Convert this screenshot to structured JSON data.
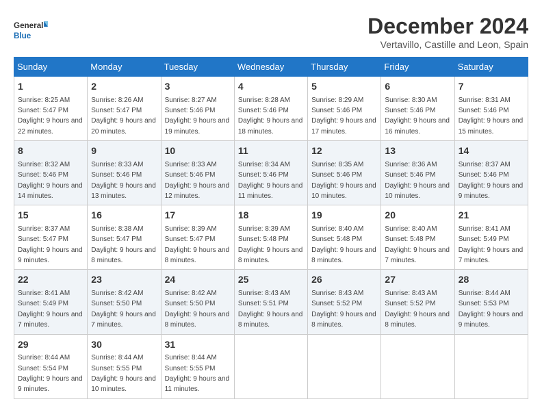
{
  "logo": {
    "general": "General",
    "blue": "Blue"
  },
  "title": "December 2024",
  "subtitle": "Vertavillo, Castille and Leon, Spain",
  "days_of_week": [
    "Sunday",
    "Monday",
    "Tuesday",
    "Wednesday",
    "Thursday",
    "Friday",
    "Saturday"
  ],
  "weeks": [
    [
      {
        "day": "1",
        "sunrise": "8:25 AM",
        "sunset": "5:47 PM",
        "daylight": "9 hours and 22 minutes."
      },
      {
        "day": "2",
        "sunrise": "8:26 AM",
        "sunset": "5:47 PM",
        "daylight": "9 hours and 20 minutes."
      },
      {
        "day": "3",
        "sunrise": "8:27 AM",
        "sunset": "5:46 PM",
        "daylight": "9 hours and 19 minutes."
      },
      {
        "day": "4",
        "sunrise": "8:28 AM",
        "sunset": "5:46 PM",
        "daylight": "9 hours and 18 minutes."
      },
      {
        "day": "5",
        "sunrise": "8:29 AM",
        "sunset": "5:46 PM",
        "daylight": "9 hours and 17 minutes."
      },
      {
        "day": "6",
        "sunrise": "8:30 AM",
        "sunset": "5:46 PM",
        "daylight": "9 hours and 16 minutes."
      },
      {
        "day": "7",
        "sunrise": "8:31 AM",
        "sunset": "5:46 PM",
        "daylight": "9 hours and 15 minutes."
      }
    ],
    [
      {
        "day": "8",
        "sunrise": "8:32 AM",
        "sunset": "5:46 PM",
        "daylight": "9 hours and 14 minutes."
      },
      {
        "day": "9",
        "sunrise": "8:33 AM",
        "sunset": "5:46 PM",
        "daylight": "9 hours and 13 minutes."
      },
      {
        "day": "10",
        "sunrise": "8:33 AM",
        "sunset": "5:46 PM",
        "daylight": "9 hours and 12 minutes."
      },
      {
        "day": "11",
        "sunrise": "8:34 AM",
        "sunset": "5:46 PM",
        "daylight": "9 hours and 11 minutes."
      },
      {
        "day": "12",
        "sunrise": "8:35 AM",
        "sunset": "5:46 PM",
        "daylight": "9 hours and 10 minutes."
      },
      {
        "day": "13",
        "sunrise": "8:36 AM",
        "sunset": "5:46 PM",
        "daylight": "9 hours and 10 minutes."
      },
      {
        "day": "14",
        "sunrise": "8:37 AM",
        "sunset": "5:46 PM",
        "daylight": "9 hours and 9 minutes."
      }
    ],
    [
      {
        "day": "15",
        "sunrise": "8:37 AM",
        "sunset": "5:47 PM",
        "daylight": "9 hours and 9 minutes."
      },
      {
        "day": "16",
        "sunrise": "8:38 AM",
        "sunset": "5:47 PM",
        "daylight": "9 hours and 8 minutes."
      },
      {
        "day": "17",
        "sunrise": "8:39 AM",
        "sunset": "5:47 PM",
        "daylight": "9 hours and 8 minutes."
      },
      {
        "day": "18",
        "sunrise": "8:39 AM",
        "sunset": "5:48 PM",
        "daylight": "9 hours and 8 minutes."
      },
      {
        "day": "19",
        "sunrise": "8:40 AM",
        "sunset": "5:48 PM",
        "daylight": "9 hours and 8 minutes."
      },
      {
        "day": "20",
        "sunrise": "8:40 AM",
        "sunset": "5:48 PM",
        "daylight": "9 hours and 7 minutes."
      },
      {
        "day": "21",
        "sunrise": "8:41 AM",
        "sunset": "5:49 PM",
        "daylight": "9 hours and 7 minutes."
      }
    ],
    [
      {
        "day": "22",
        "sunrise": "8:41 AM",
        "sunset": "5:49 PM",
        "daylight": "9 hours and 7 minutes."
      },
      {
        "day": "23",
        "sunrise": "8:42 AM",
        "sunset": "5:50 PM",
        "daylight": "9 hours and 7 minutes."
      },
      {
        "day": "24",
        "sunrise": "8:42 AM",
        "sunset": "5:50 PM",
        "daylight": "9 hours and 8 minutes."
      },
      {
        "day": "25",
        "sunrise": "8:43 AM",
        "sunset": "5:51 PM",
        "daylight": "9 hours and 8 minutes."
      },
      {
        "day": "26",
        "sunrise": "8:43 AM",
        "sunset": "5:52 PM",
        "daylight": "9 hours and 8 minutes."
      },
      {
        "day": "27",
        "sunrise": "8:43 AM",
        "sunset": "5:52 PM",
        "daylight": "9 hours and 8 minutes."
      },
      {
        "day": "28",
        "sunrise": "8:44 AM",
        "sunset": "5:53 PM",
        "daylight": "9 hours and 9 minutes."
      }
    ],
    [
      {
        "day": "29",
        "sunrise": "8:44 AM",
        "sunset": "5:54 PM",
        "daylight": "9 hours and 9 minutes."
      },
      {
        "day": "30",
        "sunrise": "8:44 AM",
        "sunset": "5:55 PM",
        "daylight": "9 hours and 10 minutes."
      },
      {
        "day": "31",
        "sunrise": "8:44 AM",
        "sunset": "5:55 PM",
        "daylight": "9 hours and 11 minutes."
      },
      null,
      null,
      null,
      null
    ]
  ]
}
